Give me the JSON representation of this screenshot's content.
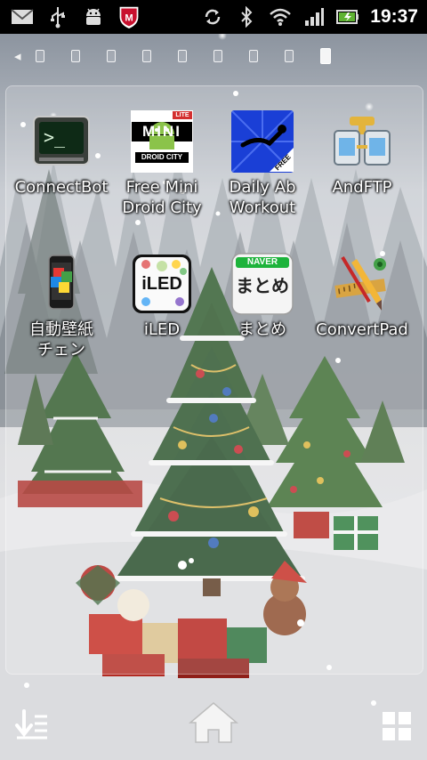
{
  "status_bar": {
    "time": "19:37",
    "left_icons": [
      "gmail-icon",
      "usb-icon",
      "android-debug-icon",
      "mcafee-icon"
    ],
    "right_icons": [
      "sync-icon",
      "bluetooth-icon",
      "wifi-icon",
      "signal-icon",
      "battery-charging-icon"
    ]
  },
  "pager": {
    "page_count": 9,
    "active_index": 9
  },
  "folder": {
    "apps": [
      {
        "label_lines": [
          "ConnectBot",
          ""
        ],
        "icon": "terminal-icon"
      },
      {
        "label_lines": [
          "Free Mini",
          "Droid City"
        ],
        "icon": "mini-droid-city-icon",
        "icon_text": [
          "LITE",
          "MINI",
          "DROID CITY"
        ]
      },
      {
        "label_lines": [
          "Daily Ab",
          "Workout"
        ],
        "icon": "ab-workout-icon",
        "icon_text": "FREE"
      },
      {
        "label_lines": [
          "AndFTP",
          ""
        ],
        "icon": "andftp-icon"
      },
      {
        "label_lines": [
          "自動壁紙",
          "チェン"
        ],
        "icon": "wallpaper-changer-icon"
      },
      {
        "label_lines": [
          "iLED",
          ""
        ],
        "icon": "iled-icon",
        "icon_text": "iLED"
      },
      {
        "label_lines": [
          "まとめ",
          ""
        ],
        "icon": "naver-matome-icon",
        "icon_text": [
          "NAVER",
          "まとめ"
        ]
      },
      {
        "label_lines": [
          "ConvertPad",
          ""
        ],
        "icon": "convertpad-icon"
      }
    ]
  },
  "dock": {
    "left": "app-drawer-icon",
    "center": "home-icon",
    "right": "grid-icon"
  }
}
